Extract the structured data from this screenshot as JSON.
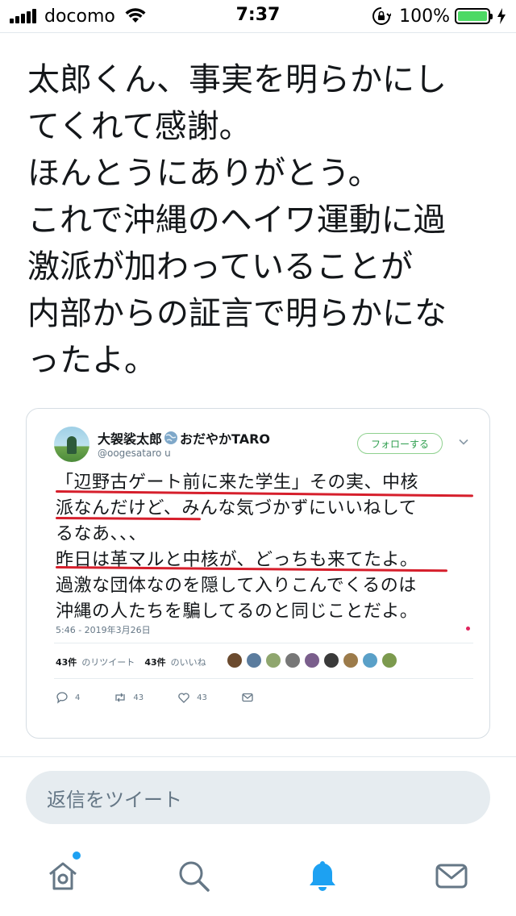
{
  "status_bar": {
    "carrier": "docomo",
    "time": "7:37",
    "battery_percent": "100%",
    "icons": [
      "signal-icon",
      "wifi-icon",
      "rotation-lock-icon",
      "battery-icon",
      "charging-icon"
    ]
  },
  "tweet": {
    "text": "太郎くん、事実を明らかにし\nてくれて感謝。\nほんとうにありがとう。\nこれで沖縄のヘイワ運動に過\n激派が加わっていることが\n内部からの証言で明らかにな\nったよ。"
  },
  "quoted_tweet": {
    "name_part1": "大袈裟太郎",
    "name_part2": "おだやかTARO",
    "handle": "@oogesataro u",
    "follow_label": "フォローする",
    "text": "「辺野古ゲート前に来た学生」その実、中核\n派なんだけど、みんな気づかずにいいねして\nるなあ、、、\n昨日は革マルと中核が、どっちも来てたよ。\n過激な団体なのを隠して入りこんでくるのは\n沖縄の人たちを騙してるのと同じことだよ。",
    "date": "5:46 - 2019年3月26日",
    "retweets_count": "43件",
    "retweets_label": "のリツイート",
    "likes_count": "43件",
    "likes_label": "のいいね",
    "reply_count": "4",
    "retweet_action_count": "43",
    "like_action_count": "43",
    "underline_color": "#d61f2c"
  },
  "reply": {
    "placeholder": "返信をツイート"
  },
  "tab_bar": {
    "items": [
      "home-icon",
      "search-icon",
      "notifications-icon",
      "messages-icon"
    ],
    "active_color": "#1da1f2"
  },
  "colors": {
    "accent": "#1da1f2",
    "battery": "#4cd964",
    "follow_green": "#2e9e4e"
  }
}
